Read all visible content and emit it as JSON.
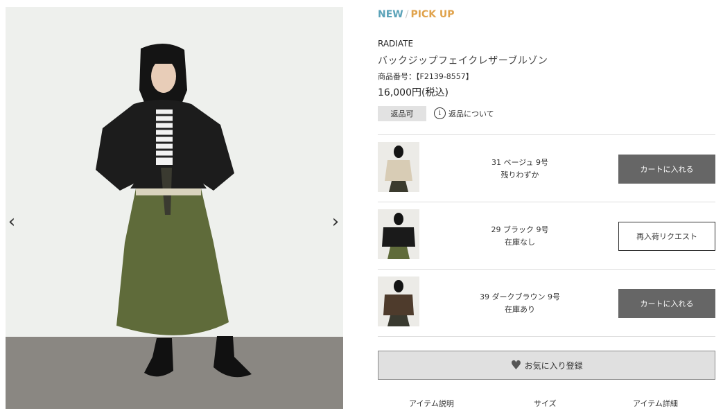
{
  "gallery": {
    "prev_icon": "chevron-left-icon",
    "next_icon": "chevron-right-icon",
    "prev_glyph": "‹",
    "next_glyph": "›"
  },
  "labels": {
    "new": "NEW",
    "separator": "/",
    "pick_up": "PICK UP",
    "new_color": "#5aa2b8",
    "pick_up_color": "#e0a24b"
  },
  "product": {
    "brand": "RADIATE",
    "name": "バックジップフェイクレザーブルゾン",
    "code": "商品番号：【F2139-8557】",
    "price": "16,000円(税込)",
    "return_badge": "返品可",
    "return_info": "返品について",
    "return_info_icon": "info-icon",
    "return_info_glyph": "i"
  },
  "variants": [
    {
      "label": "31 ベージュ 9号",
      "stock": "残りわずか",
      "button": "カートに入れる"
    },
    {
      "label": "29 ブラック 9号",
      "stock": "在庫なし",
      "button": "再入荷リクエスト"
    },
    {
      "label": "39 ダークブラウン 9号",
      "stock": "在庫あり",
      "button": "カートに入れる"
    }
  ],
  "favorite": {
    "label": "お気に入り登録",
    "icon": "heart-icon",
    "glyph": "♥"
  },
  "tabs": [
    "アイテム説明",
    "サイズ",
    "アイテム詳細"
  ],
  "colors": {
    "cart_button": "#666666",
    "divider": "#dddddd",
    "favorite_bg": "#e0e0e0"
  }
}
